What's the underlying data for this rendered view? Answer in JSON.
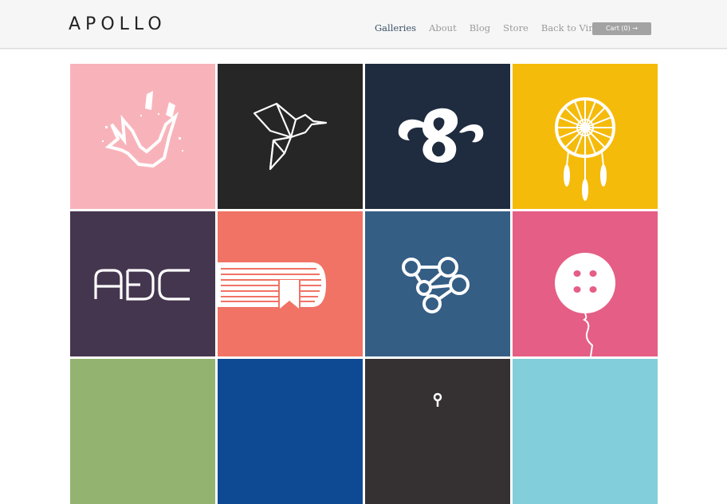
{
  "header": {
    "logo": "APOLLO",
    "nav": [
      {
        "label": "Galleries",
        "active": true
      },
      {
        "label": "About",
        "active": false
      },
      {
        "label": "Blog",
        "active": false
      },
      {
        "label": "Store",
        "active": false
      },
      {
        "label": "Back to Virb",
        "active": false
      }
    ],
    "cart_label": "Cart (0) →"
  },
  "gallery": {
    "tiles": [
      {
        "icon": "broken-v-icon",
        "color": "#f8b3ba"
      },
      {
        "icon": "origami-hummingbird-icon",
        "color": "#262626"
      },
      {
        "icon": "ampersand-icon",
        "color": "#1f2b3e"
      },
      {
        "icon": "dreamcatcher-icon",
        "color": "#f5bb0b"
      },
      {
        "icon": "abc-letters-icon",
        "color": "#45364f"
      },
      {
        "icon": "book-bookmark-icon",
        "color": "#f07365"
      },
      {
        "icon": "network-nodes-icon",
        "color": "#355e85"
      },
      {
        "icon": "button-balloon-icon",
        "color": "#e55e85"
      },
      {
        "icon": "tile-icon",
        "color": "#93b470"
      },
      {
        "icon": "tile-icon",
        "color": "#0e4a94"
      },
      {
        "icon": "tile-icon",
        "color": "#353132"
      },
      {
        "icon": "tile-icon",
        "color": "#83cedb"
      }
    ],
    "abc_text": "ABC"
  }
}
